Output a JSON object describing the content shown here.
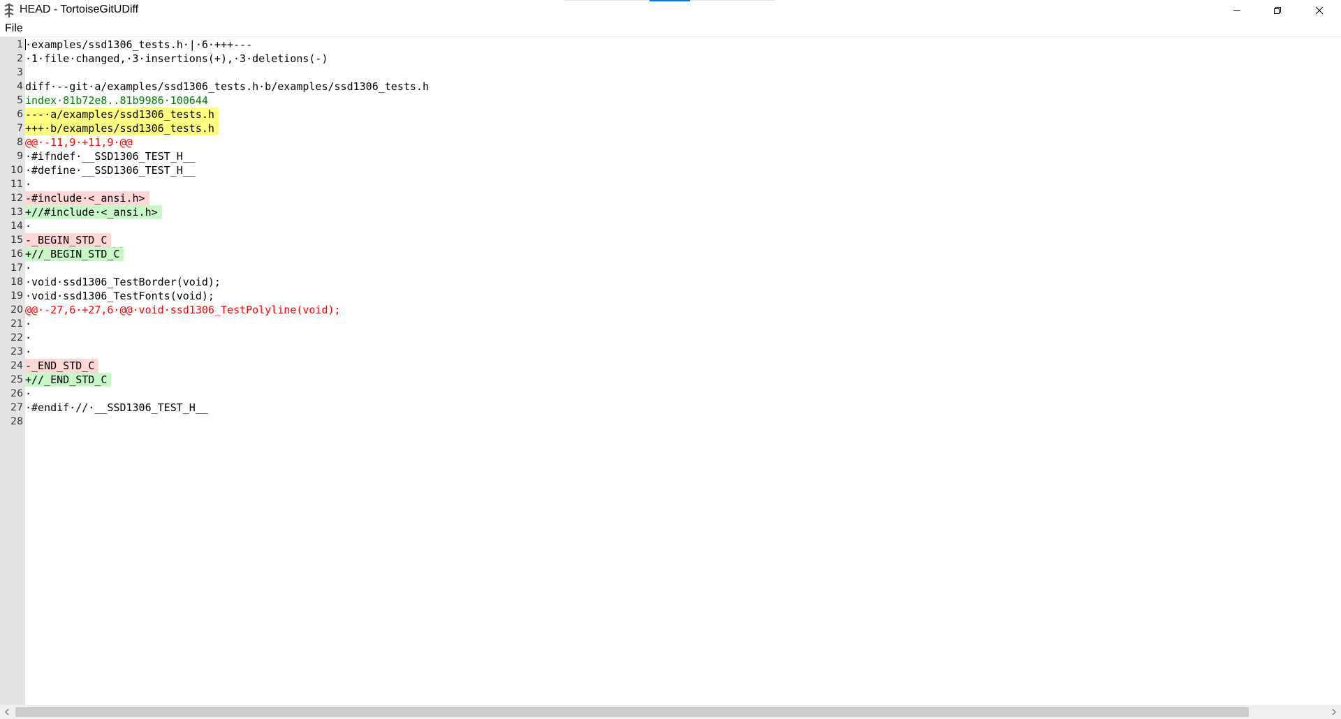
{
  "window": {
    "title": "HEAD - TortoiseGitUDiff"
  },
  "menu": {
    "file": "File"
  },
  "colors": {
    "added_bg": "#c8f7c8",
    "removed_bg": "#ffd7d7",
    "file_header_bg": "#ffff80",
    "hunk_fg": "#ff0000",
    "index_fg": "#008000"
  },
  "lines": [
    {
      "n": "1",
      "text": "·examples/ssd1306_tests.h·|·6·+++---",
      "type": "normal"
    },
    {
      "n": "2",
      "text": "·1·file·changed,·3·insertions(+),·3·deletions(-)",
      "type": "normal"
    },
    {
      "n": "3",
      "text": "",
      "type": "normal"
    },
    {
      "n": "4",
      "text": "diff·--git·a/examples/ssd1306_tests.h·b/examples/ssd1306_tests.h",
      "type": "head"
    },
    {
      "n": "5",
      "text": "index·81b72e8..81b9986·100644",
      "type": "index"
    },
    {
      "n": "6",
      "text": "---·a/examples/ssd1306_tests.h",
      "type": "file"
    },
    {
      "n": "7",
      "text": "+++·b/examples/ssd1306_tests.h",
      "type": "file"
    },
    {
      "n": "8",
      "text": "@@·-11,9·+11,9·@@",
      "type": "hunk"
    },
    {
      "n": "9",
      "text": "·#ifndef·__SSD1306_TEST_H__",
      "type": "normal"
    },
    {
      "n": "10",
      "text": "·#define·__SSD1306_TEST_H__",
      "type": "normal"
    },
    {
      "n": "11",
      "text": "·",
      "type": "normal"
    },
    {
      "n": "12",
      "text": "-#include·<_ansi.h>",
      "type": "del"
    },
    {
      "n": "13",
      "text": "+//#include·<_ansi.h>",
      "type": "add"
    },
    {
      "n": "14",
      "text": "·",
      "type": "normal"
    },
    {
      "n": "15",
      "text": "-_BEGIN_STD_C",
      "type": "del"
    },
    {
      "n": "16",
      "text": "+//_BEGIN_STD_C",
      "type": "add"
    },
    {
      "n": "17",
      "text": "·",
      "type": "normal"
    },
    {
      "n": "18",
      "text": "·void·ssd1306_TestBorder(void);",
      "type": "normal"
    },
    {
      "n": "19",
      "text": "·void·ssd1306_TestFonts(void);",
      "type": "normal"
    },
    {
      "n": "20",
      "text": "@@·-27,6·+27,6·@@·void·ssd1306_TestPolyline(void);",
      "type": "hunk"
    },
    {
      "n": "21",
      "text": "·",
      "type": "normal"
    },
    {
      "n": "22",
      "text": "·",
      "type": "normal"
    },
    {
      "n": "23",
      "text": "·",
      "type": "normal"
    },
    {
      "n": "24",
      "text": "-_END_STD_C",
      "type": "del"
    },
    {
      "n": "25",
      "text": "+//_END_STD_C",
      "type": "add"
    },
    {
      "n": "26",
      "text": "·",
      "type": "normal"
    },
    {
      "n": "27",
      "text": "·#endif·//·__SSD1306_TEST_H__",
      "type": "normal"
    },
    {
      "n": "28",
      "text": "",
      "type": "normal"
    }
  ]
}
